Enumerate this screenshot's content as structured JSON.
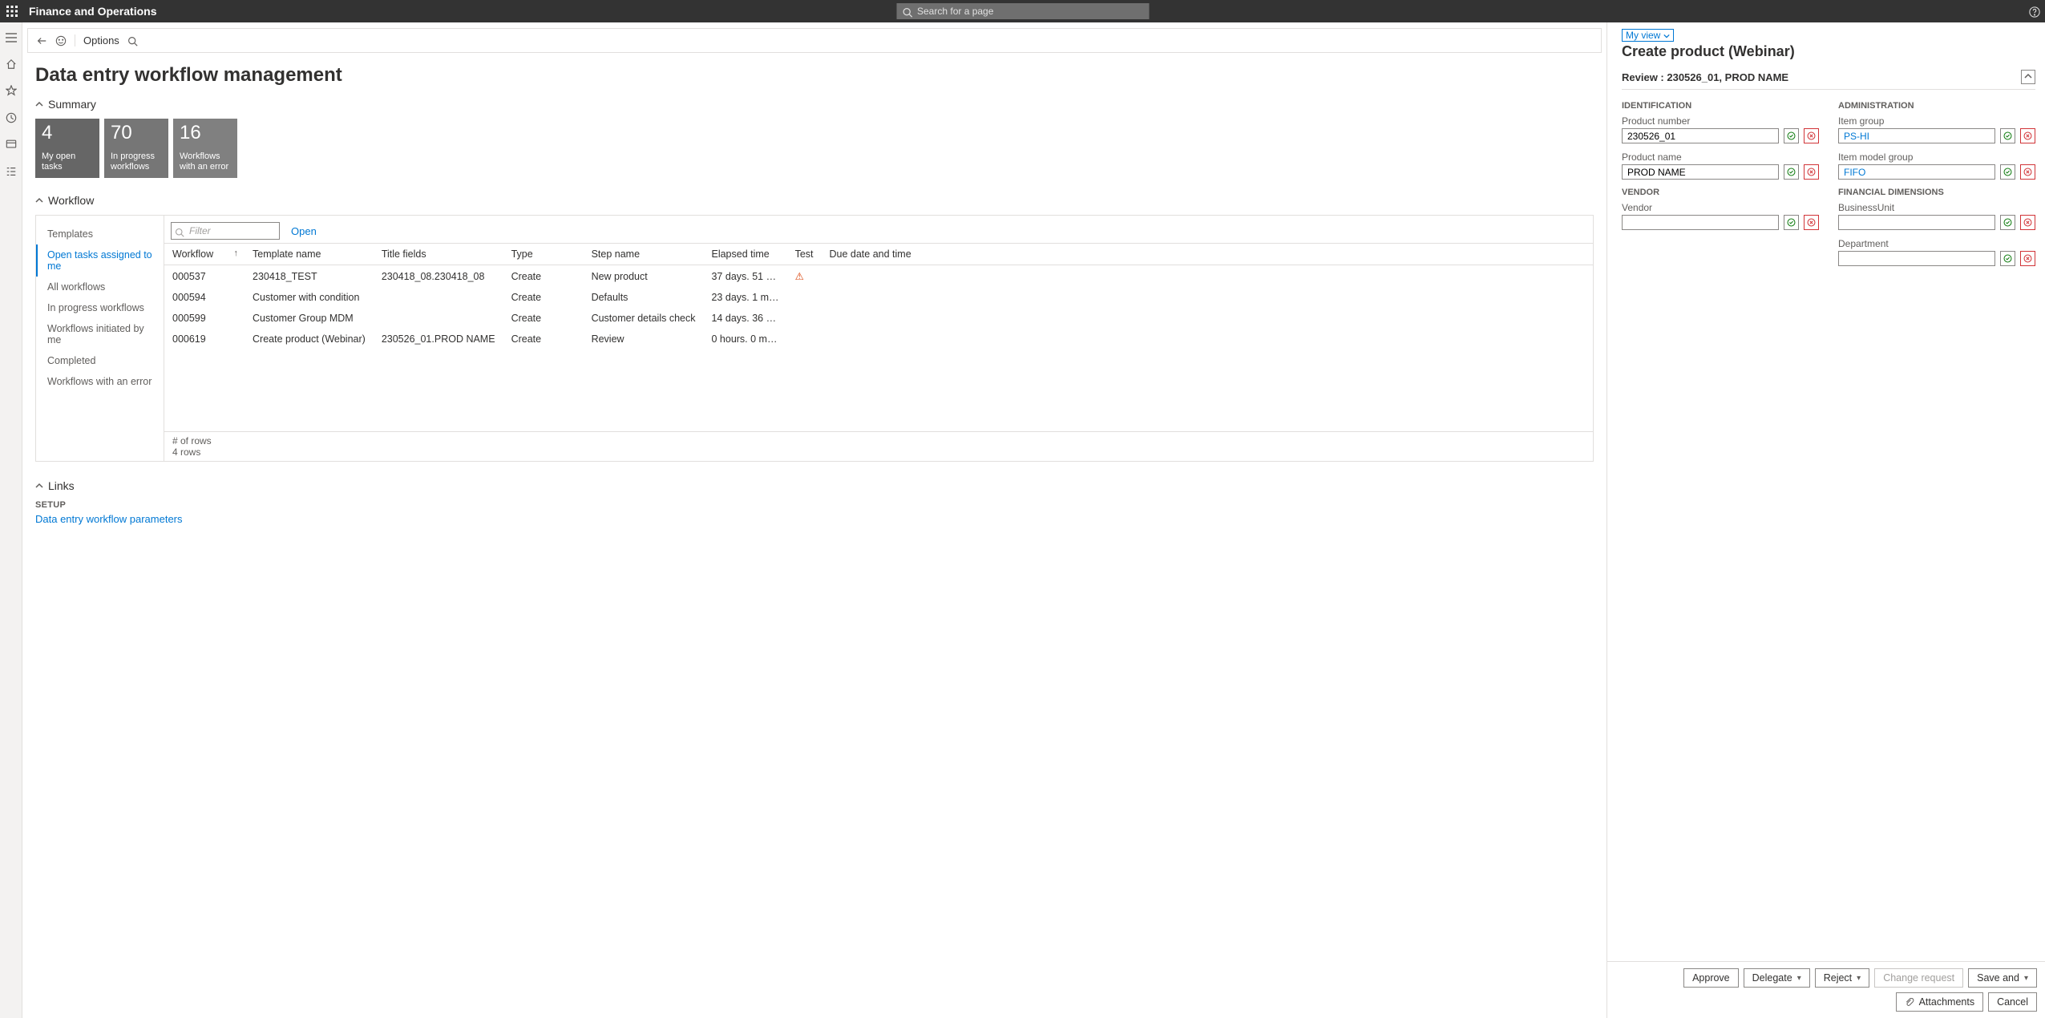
{
  "header": {
    "app_title": "Finance and Operations",
    "search_placeholder": "Search for a page"
  },
  "action_bar": {
    "options": "Options"
  },
  "page": {
    "title": "Data entry workflow management"
  },
  "sections": {
    "summary": "Summary",
    "workflow": "Workflow",
    "links": "Links"
  },
  "cards": [
    {
      "count": "4",
      "label": "My open tasks"
    },
    {
      "count": "70",
      "label": "In progress workflows"
    },
    {
      "count": "16",
      "label": "Workflows with an error"
    }
  ],
  "wf_nav": {
    "items": [
      "Templates",
      "Open tasks assigned to me",
      "All workflows",
      "In progress workflows",
      "Workflows initiated by me",
      "Completed",
      "Workflows with an error"
    ],
    "selected_index": 1
  },
  "wf_toolbar": {
    "filter_placeholder": "Filter",
    "open": "Open"
  },
  "grid": {
    "columns": [
      "Workflow",
      "Template name",
      "Title fields",
      "Type",
      "Step name",
      "Elapsed time",
      "Test",
      "Due date and time"
    ],
    "rows": [
      {
        "workflow": "000537",
        "template": "230418_TEST",
        "title": "230418_08.230418_08",
        "type": "Create",
        "step": "New product",
        "elapsed": "37 days. 51 …",
        "test_warn": true,
        "due": ""
      },
      {
        "workflow": "000594",
        "template": "Customer with condition",
        "title": "",
        "type": "Create",
        "step": "Defaults",
        "elapsed": "23 days. 1 m…",
        "test_warn": false,
        "due": ""
      },
      {
        "workflow": "000599",
        "template": "Customer Group MDM",
        "title": "",
        "type": "Create",
        "step": "Customer details check",
        "elapsed": "14 days. 36 …",
        "test_warn": false,
        "due": ""
      },
      {
        "workflow": "000619",
        "template": "Create product (Webinar)",
        "title": "230526_01.PROD NAME",
        "type": "Create",
        "step": "Review",
        "elapsed": "0 hours. 0 m…",
        "test_warn": false,
        "due": ""
      }
    ],
    "footer_label": "# of rows",
    "footer_count": "4 rows"
  },
  "links": {
    "group_label": "SETUP",
    "items": [
      "Data entry workflow parameters"
    ]
  },
  "panel": {
    "view_label": "My view",
    "title": "Create product (Webinar)",
    "review_line": "Review : 230526_01, PROD NAME",
    "left": {
      "identification": {
        "label": "IDENTIFICATION",
        "product_number_label": "Product number",
        "product_number_value": "230526_01",
        "product_name_label": "Product name",
        "product_name_value": "PROD NAME"
      },
      "vendor": {
        "label": "VENDOR",
        "vendor_label": "Vendor",
        "vendor_value": ""
      }
    },
    "right": {
      "administration": {
        "label": "ADMINISTRATION",
        "item_group_label": "Item group",
        "item_group_value": "PS-HI",
        "item_model_group_label": "Item model group",
        "item_model_group_value": "FIFO"
      },
      "financial": {
        "label": "FINANCIAL DIMENSIONS",
        "business_unit_label": "BusinessUnit",
        "business_unit_value": "",
        "department_label": "Department",
        "department_value": ""
      }
    },
    "footer": {
      "approve": "Approve",
      "delegate": "Delegate",
      "reject": "Reject",
      "change_request": "Change request",
      "save_and": "Save and",
      "attachments": "Attachments",
      "cancel": "Cancel"
    }
  }
}
